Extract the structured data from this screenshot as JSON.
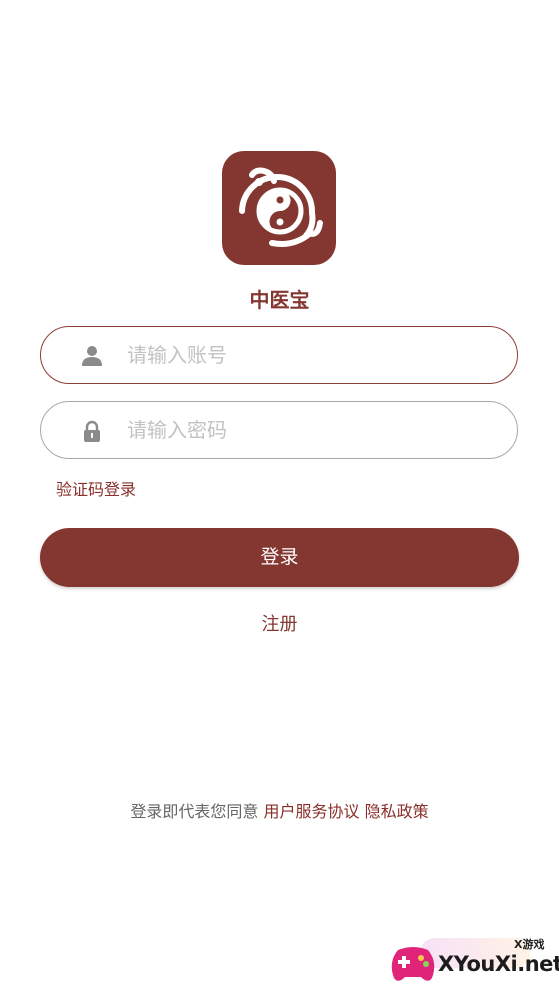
{
  "app": {
    "name": "中医宝",
    "logo_icon": "yin-yang-gourd-icon",
    "brand_color": "#833730"
  },
  "login_form": {
    "account": {
      "placeholder": "请输入账号",
      "value": "",
      "icon": "user-icon"
    },
    "password": {
      "placeholder": "请输入密码",
      "value": "",
      "icon": "lock-icon"
    },
    "sms_login_label": "验证码登录",
    "login_button_label": "登录",
    "register_label": "注册"
  },
  "agreement": {
    "prefix": "登录即代表您同意",
    "user_agreement": "用户服务协议",
    "privacy_policy": "隐私政策"
  },
  "watermark": {
    "tag": "X游戏",
    "site": "XYouXi.net"
  }
}
